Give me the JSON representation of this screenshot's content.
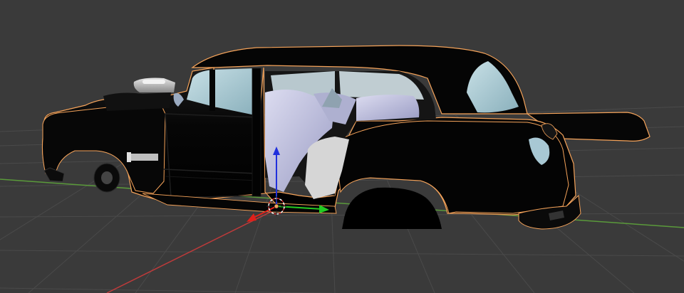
{
  "viewport": {
    "name": "3D Viewport",
    "background_color": "#3a3a3a",
    "grid_color": "#4a4a4a",
    "x_axis_color": "#c03a3a",
    "y_axis_color": "#5a9a3a"
  },
  "selected_object": {
    "type": "car body mesh",
    "outline_color": "#f5a35a",
    "body_color": "#050505",
    "interior_color": "#b4b6d6"
  },
  "gizmo": {
    "x_color": "#e0201a",
    "y_color": "#22cc22",
    "z_color": "#2030dd"
  },
  "origin": {
    "icon": "3d-cursor-icon"
  }
}
